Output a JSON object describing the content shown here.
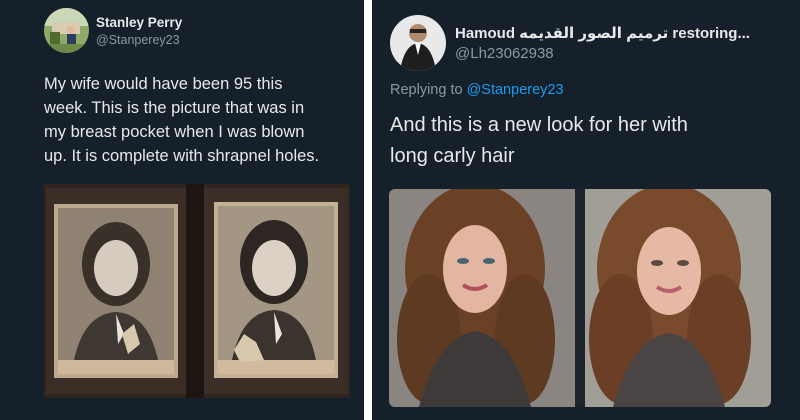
{
  "left_tweet": {
    "author_name": "Stanley Perry",
    "author_handle": "@Stanperey23",
    "text_lines": [
      "My wife would have been 95 this",
      "week. This is the picture that was in",
      "my breast pocket when I was blown",
      "up. It is complete with shrapnel holes."
    ]
  },
  "right_tweet": {
    "author_name": "Hamoud ترميم الصور القديمه restoring...",
    "author_handle": "@Lh23062938",
    "reply_prefix": "Replying to",
    "reply_mention": "@Stanperey23",
    "text_lines": [
      "And this is a new look for her with",
      "long carly hair"
    ]
  },
  "colors": {
    "background": "#15202b",
    "text": "#e7e9ea",
    "secondary": "#8b98a5",
    "link": "#1d9bf0",
    "divider": "#ffffff"
  },
  "icons": [
    "avatar-stanley",
    "avatar-hamoud"
  ]
}
